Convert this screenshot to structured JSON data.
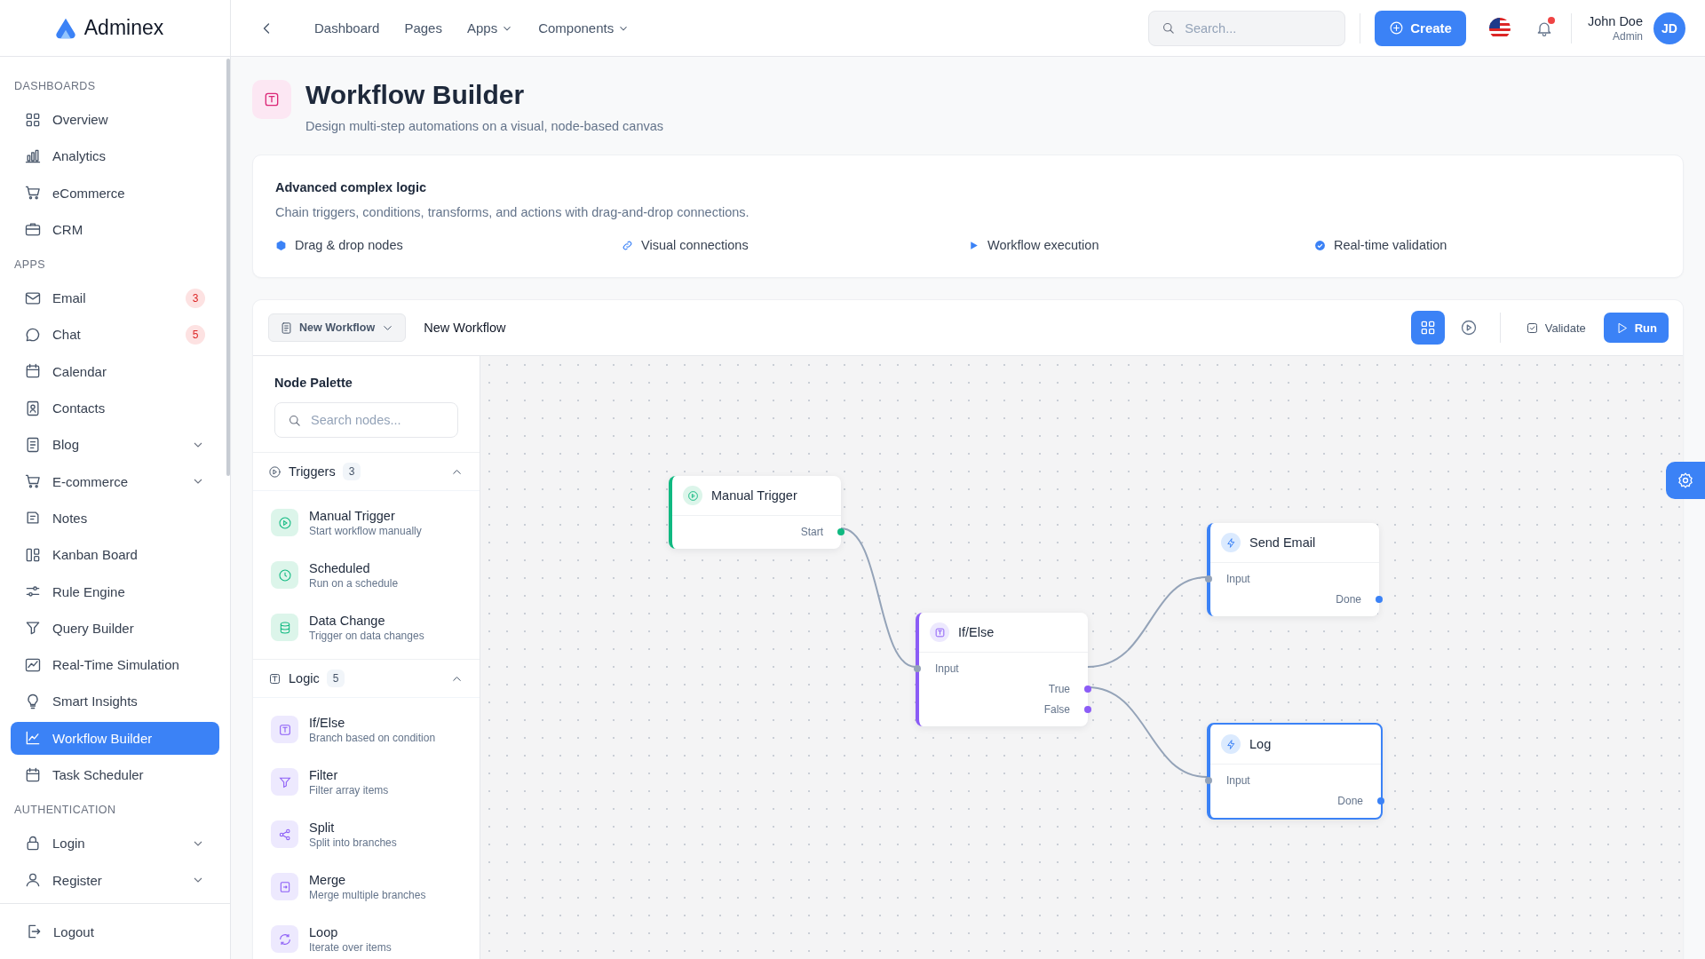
{
  "brand": {
    "name": "Adminex"
  },
  "sidebar": {
    "sections": [
      {
        "label": "DASHBOARDS",
        "items": [
          {
            "label": "Overview",
            "selected": false,
            "expandable": false
          },
          {
            "label": "Analytics",
            "selected": false,
            "expandable": false
          },
          {
            "label": "eCommerce",
            "selected": false,
            "expandable": false
          },
          {
            "label": "CRM",
            "selected": false,
            "expandable": false
          }
        ]
      },
      {
        "label": "APPS",
        "items": [
          {
            "label": "Email",
            "selected": false,
            "expandable": false,
            "badge": "3"
          },
          {
            "label": "Chat",
            "selected": false,
            "expandable": false,
            "badge": "5"
          },
          {
            "label": "Calendar",
            "selected": false,
            "expandable": false
          },
          {
            "label": "Contacts",
            "selected": false,
            "expandable": false
          },
          {
            "label": "Blog",
            "selected": false,
            "expandable": true
          },
          {
            "label": "E-commerce",
            "selected": false,
            "expandable": true
          },
          {
            "label": "Notes",
            "selected": false,
            "expandable": false
          },
          {
            "label": "Kanban Board",
            "selected": false,
            "expandable": false
          },
          {
            "label": "Rule Engine",
            "selected": false,
            "expandable": false
          },
          {
            "label": "Query Builder",
            "selected": false,
            "expandable": false
          },
          {
            "label": "Real-Time Simulation",
            "selected": false,
            "expandable": false
          },
          {
            "label": "Smart Insights",
            "selected": false,
            "expandable": false
          },
          {
            "label": "Workflow Builder",
            "selected": true,
            "expandable": false
          },
          {
            "label": "Task Scheduler",
            "selected": false,
            "expandable": false
          }
        ]
      },
      {
        "label": "AUTHENTICATION",
        "items": [
          {
            "label": "Login",
            "selected": false,
            "expandable": true
          },
          {
            "label": "Register",
            "selected": false,
            "expandable": true
          }
        ]
      }
    ],
    "logout": "Logout"
  },
  "topbar": {
    "nav": [
      {
        "label": "Dashboard",
        "dropdown": false
      },
      {
        "label": "Pages",
        "dropdown": false
      },
      {
        "label": "Apps",
        "dropdown": true
      },
      {
        "label": "Components",
        "dropdown": true
      }
    ],
    "search": {
      "placeholder": "Search..."
    },
    "create_button": "Create",
    "notifications": {
      "unread": true
    },
    "user": {
      "name": "John Doe",
      "role": "Admin",
      "initials": "JD"
    }
  },
  "page": {
    "title": "Workflow Builder",
    "subtitle": "Design multi-step automations on a visual, node-based canvas"
  },
  "feature_card": {
    "title": "Advanced complex logic",
    "description": "Chain triggers, conditions, transforms, and actions with drag-and-drop connections.",
    "features": [
      "Drag & drop nodes",
      "Visual connections",
      "Workflow execution",
      "Real-time validation"
    ]
  },
  "builder": {
    "workflow_select": "New Workflow",
    "workflow_name": "New Workflow",
    "view_buttons": [
      {
        "selected": true
      },
      {
        "selected": false
      }
    ],
    "validate_button": "Validate",
    "run_button": "Run",
    "palette": {
      "title": "Node Palette",
      "search": {
        "placeholder": "Search nodes..."
      },
      "groups": [
        {
          "kind": "trigger",
          "label": "Triggers",
          "count": "3",
          "expanded": true,
          "items": [
            {
              "name": "Manual Trigger",
              "description": "Start workflow manually"
            },
            {
              "name": "Scheduled",
              "description": "Run on a schedule"
            },
            {
              "name": "Data Change",
              "description": "Trigger on data changes"
            }
          ]
        },
        {
          "kind": "logic",
          "label": "Logic",
          "count": "5",
          "expanded": true,
          "items": [
            {
              "name": "If/Else",
              "description": "Branch based on condition"
            },
            {
              "name": "Filter",
              "description": "Filter array items"
            },
            {
              "name": "Split",
              "description": "Split into branches"
            },
            {
              "name": "Merge",
              "description": "Merge multiple branches"
            },
            {
              "name": "Loop",
              "description": "Iterate over items"
            }
          ]
        }
      ]
    },
    "canvas": {
      "nodes": [
        {
          "kind": "trigger",
          "title": "Manual Trigger",
          "outputs": [
            "Start"
          ],
          "selected": false
        },
        {
          "kind": "logic",
          "title": "If/Else",
          "inputs": [
            "Input"
          ],
          "outputs": [
            "True",
            "False"
          ],
          "selected": false
        },
        {
          "kind": "action",
          "title": "Send Email",
          "inputs": [
            "Input"
          ],
          "outputs": [
            "Done"
          ],
          "selected": false
        },
        {
          "kind": "action",
          "title": "Log",
          "inputs": [
            "Input"
          ],
          "outputs": [
            "Done"
          ],
          "selected": true
        }
      ]
    }
  }
}
